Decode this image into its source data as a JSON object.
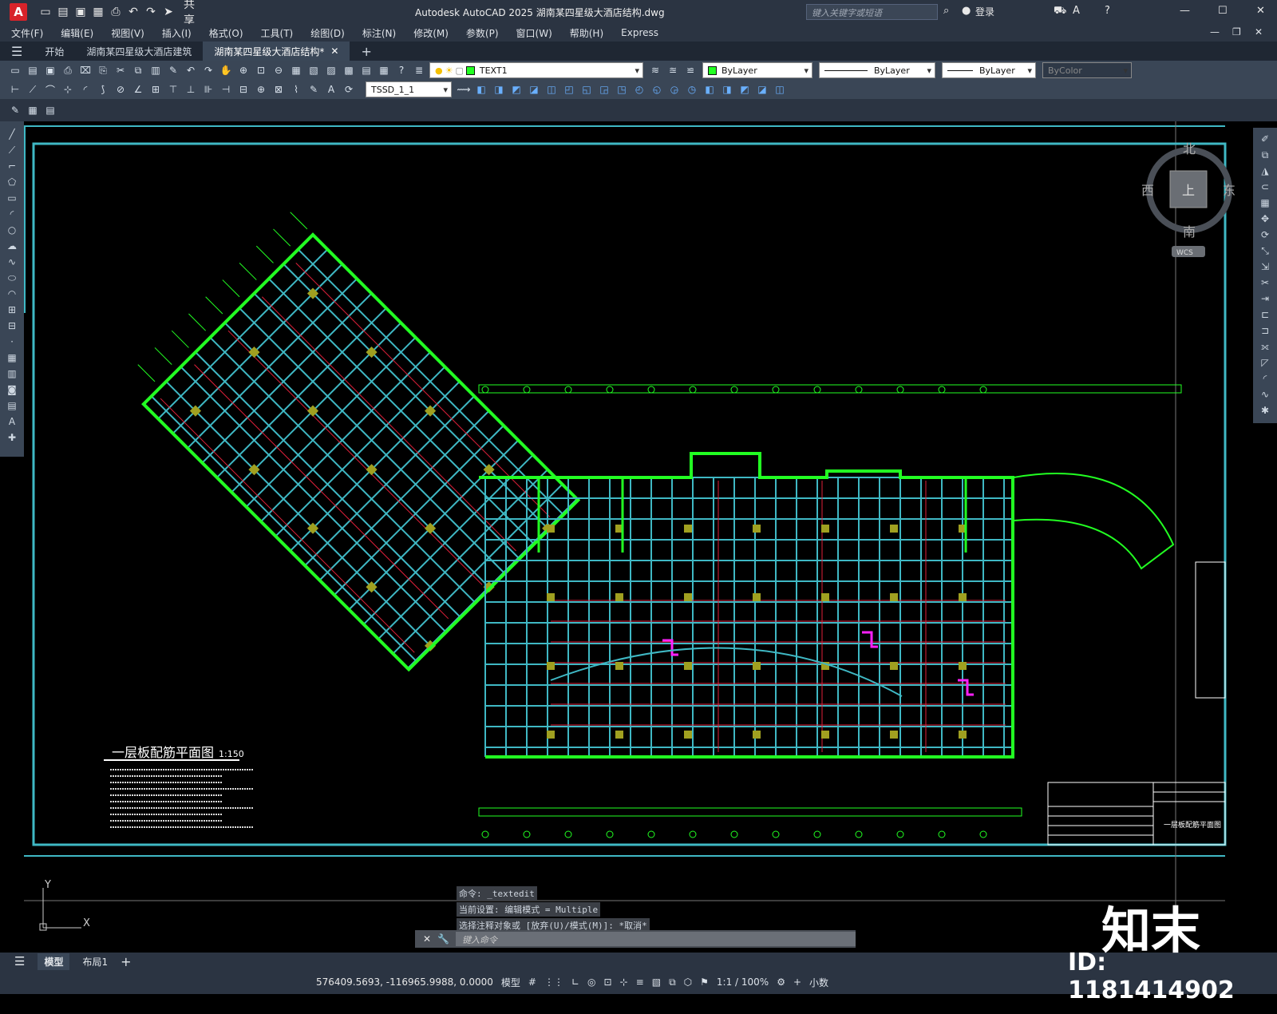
{
  "titlebar": {
    "app_title": "Autodesk AutoCAD 2025    湖南某四星级大酒店结构.dwg",
    "share": "共享",
    "search_placeholder": "键入关键字或短语",
    "login": "登录"
  },
  "menu": [
    "文件(F)",
    "编辑(E)",
    "视图(V)",
    "插入(I)",
    "格式(O)",
    "工具(T)",
    "绘图(D)",
    "标注(N)",
    "修改(M)",
    "参数(P)",
    "窗口(W)",
    "帮助(H)",
    "Express"
  ],
  "tabs": {
    "start": "开始",
    "tab1": "湖南某四星级大酒店建筑",
    "tab2": "湖南某四星级大酒店结构*"
  },
  "toolbar": {
    "layer": "TEXT1",
    "color": "ByLayer",
    "linetype": "ByLayer",
    "lineweight": "ByLayer",
    "plotstyle": "ByColor",
    "dimstyle": "TSSD_1_1"
  },
  "viewcube": {
    "north": "北",
    "south": "南",
    "east": "东",
    "west": "西",
    "top": "上",
    "wcs": "WCS"
  },
  "drawing": {
    "title": "一层板配筋平面图",
    "scale": "1:150",
    "titleblock_name": "一层板配筋平面图",
    "ucs_x": "X",
    "ucs_y": "Y"
  },
  "command": {
    "lines": [
      "命令: _textedit",
      "当前设置: 编辑模式 = Multiple",
      "选择注释对象或 [放弃(U)/模式(M)]: *取消*"
    ],
    "placeholder": "键入命令"
  },
  "bottom_tabs": {
    "model": "模型",
    "layout1": "布局1"
  },
  "status": {
    "coords": "576409.5693, -116965.9988, 0.0000",
    "model": "模型",
    "scale": "1:1 / 100%",
    "units": "小数"
  },
  "watermark": {
    "brand": "知末",
    "id": "ID: 1181414902"
  },
  "colors": {
    "green": "#22ff22",
    "cyan": "#3fb8c4",
    "red": "#e0203a",
    "magenta": "#ff20ff",
    "olive": "#a0a020"
  }
}
